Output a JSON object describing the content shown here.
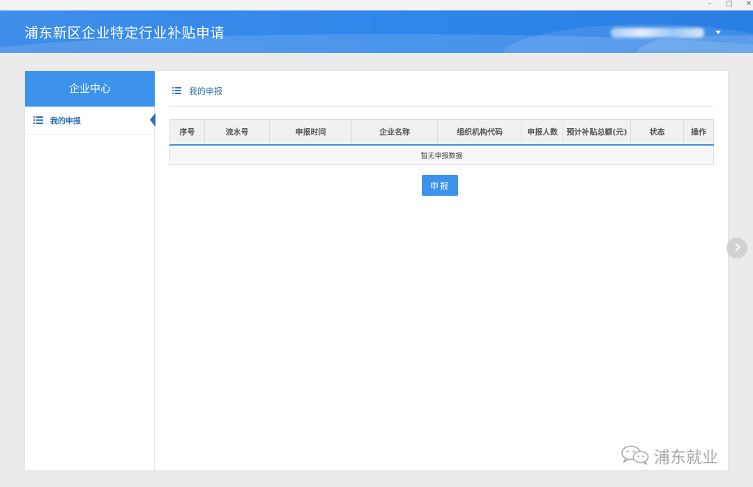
{
  "window": {
    "minimize_glyph": "–",
    "maximize_glyph": "□",
    "close_glyph": "✕"
  },
  "header": {
    "title": "浦东新区企业特定行业补贴申请"
  },
  "sidebar": {
    "title": "企业中心",
    "items": [
      {
        "label": "我的申报",
        "icon": "list-icon",
        "active": true
      }
    ]
  },
  "main": {
    "section_title": "我的申报",
    "table": {
      "columns": [
        "序号",
        "流水号",
        "申报时间",
        "企业名称",
        "组织机构代码",
        "申报人数",
        "预计补贴总额(元)",
        "状态",
        "操作"
      ],
      "empty_text": "暂无申报数据"
    },
    "submit_label": "申报"
  },
  "watermark": {
    "text": "浦东就业",
    "icon": "wechat-icon"
  },
  "colors": {
    "accent": "#3d93eb",
    "nav_text": "#2e6fb6",
    "header_bg": "#2f86ea"
  }
}
